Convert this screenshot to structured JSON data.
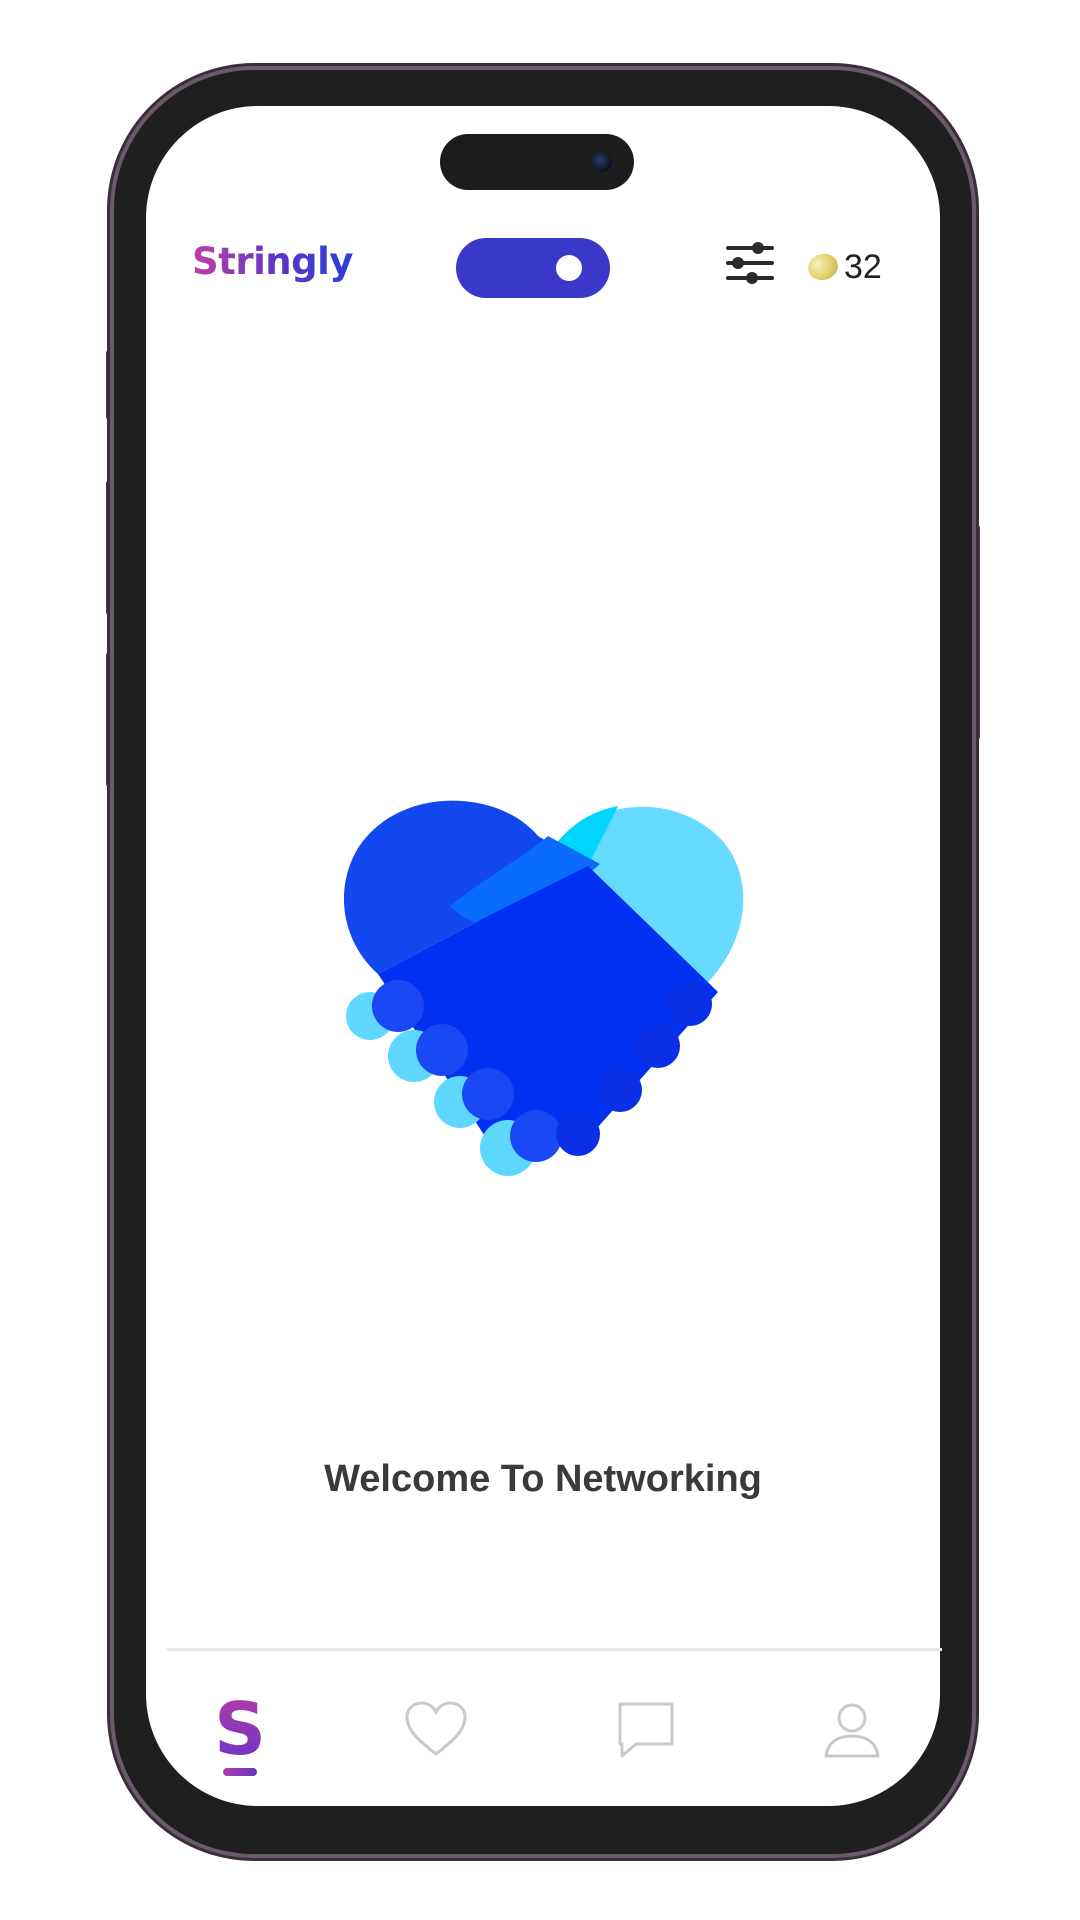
{
  "header": {
    "app_name": "Stringly",
    "coin_count": "32"
  },
  "main": {
    "welcome_text": "Welcome To Networking"
  },
  "icons": {
    "filter": "sliders-icon",
    "coin": "coin-icon",
    "logo": "heart-handshake-icon",
    "nav": [
      "stringly-s-icon",
      "heart-icon",
      "chat-bubble-icon",
      "profile-icon"
    ]
  },
  "colors": {
    "brand_purple": "#8a37b8",
    "toggle_blue": "#3a38c9",
    "heart_dark_blue": "#0a2ff0",
    "heart_light_blue": "#5fd8ff"
  },
  "bottom_nav": {
    "active_index": 0
  }
}
